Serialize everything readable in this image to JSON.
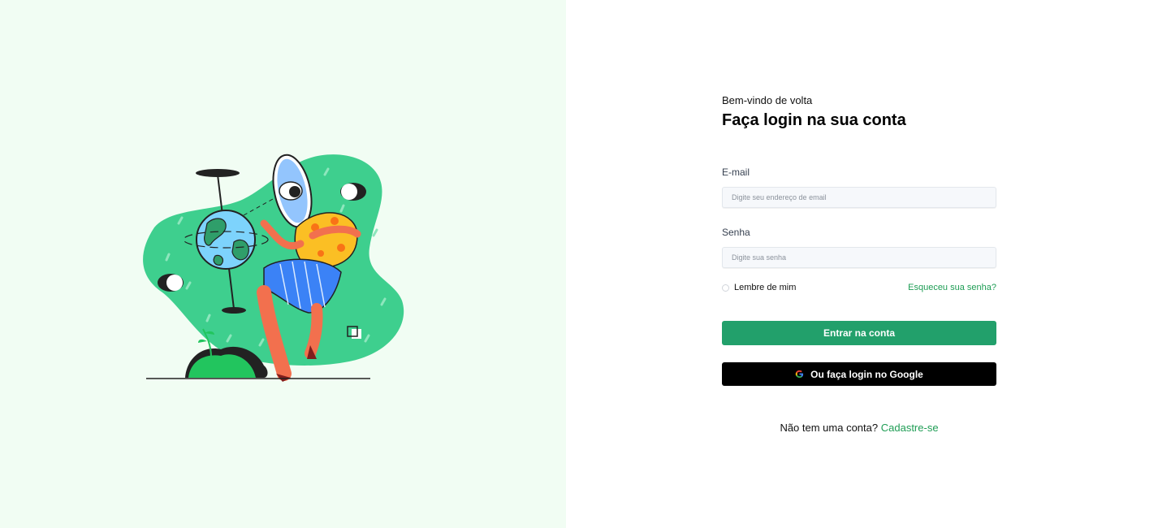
{
  "illustration": {
    "icon": "person-with-globe-and-mirror-illustration"
  },
  "form": {
    "welcome": "Bem-vindo de volta",
    "title": "Faça login na sua conta",
    "email_label": "E-mail",
    "email_placeholder": "Digite seu endereço de email",
    "password_label": "Senha",
    "password_placeholder": "Digite sua senha",
    "remember_label": "Lembre de mim",
    "forgot_link": "Esqueceu sua senha?",
    "submit_label": "Entrar na conta",
    "google_label": "Ou faça login no Google",
    "no_account_text": "Não tem uma conta?",
    "signup_link": "Cadastre-se"
  },
  "colors": {
    "left_bg": "#f1fdf3",
    "accent_green": "#22a06b",
    "link_green": "#1f9d55",
    "google_button_bg": "#000000"
  }
}
